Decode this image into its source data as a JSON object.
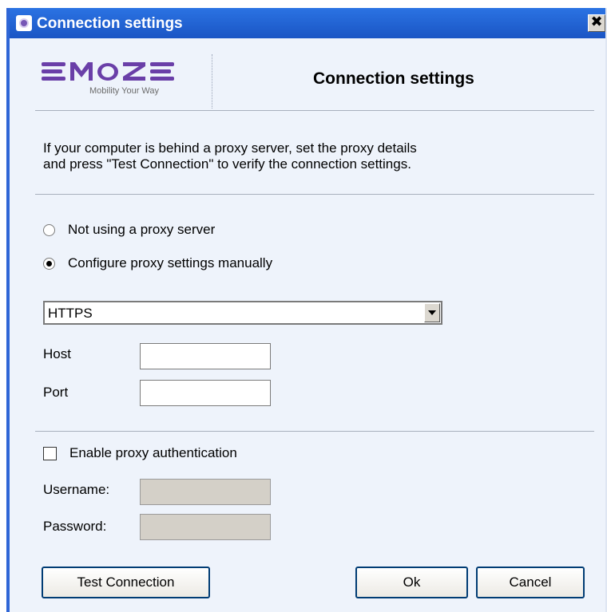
{
  "window": {
    "title": "Connection settings",
    "close_glyph": "✖",
    "titlebar_color": "#1f5fd0"
  },
  "header": {
    "logo_text": "EMOZE",
    "logo_tagline": "Mobility Your Way",
    "title": "Connection settings"
  },
  "description": {
    "line1": "If your computer is behind a proxy server, set the proxy details",
    "line2": "and press \"Test Connection\" to verify the connection settings."
  },
  "proxy_options": {
    "no_proxy_label": "Not using a proxy server",
    "manual_label": "Configure proxy settings manually",
    "selected": "manual"
  },
  "protocol": {
    "selected": "HTTPS"
  },
  "fields": {
    "host_label": "Host",
    "host_value": "",
    "port_label": "Port",
    "port_value": ""
  },
  "auth": {
    "enable_label": "Enable proxy authentication",
    "enabled": false,
    "username_label": "Username:",
    "username_value": "",
    "password_label": "Password:",
    "password_value": ""
  },
  "buttons": {
    "test_connection": "Test Connection",
    "ok": "Ok",
    "cancel": "Cancel"
  },
  "icons": {
    "app": "app-icon",
    "close": "close-icon",
    "dropdown": "chevron-down-icon"
  },
  "colors": {
    "dialog_bg": "#eef3fb",
    "button_border": "#003c74",
    "logo": "#6a3fa8"
  }
}
